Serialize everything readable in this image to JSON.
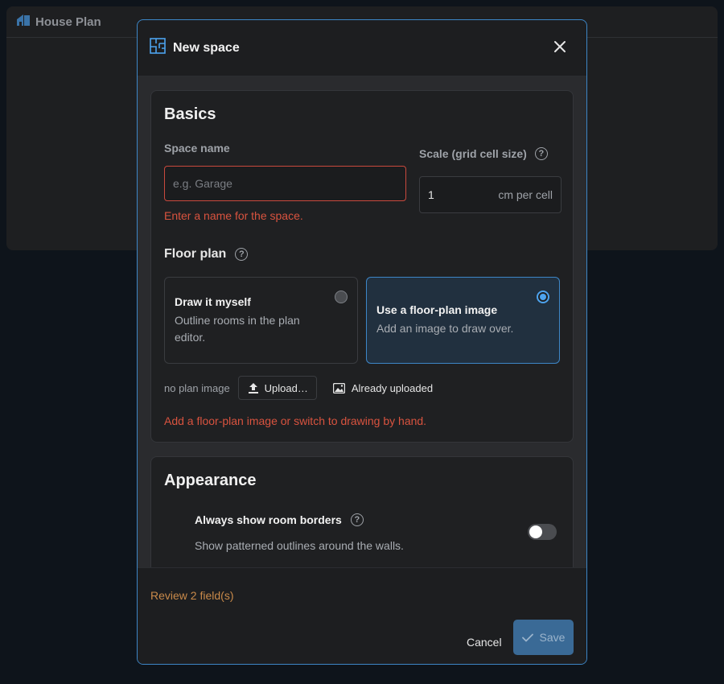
{
  "app": {
    "title": "House Plan"
  },
  "dialog": {
    "title": "New space",
    "basics": {
      "title": "Basics",
      "name_label": "Space name",
      "name_placeholder": "e.g. Garage",
      "name_value": "",
      "name_error": "Enter a name for the space.",
      "scale_label": "Scale (grid cell size)",
      "scale_value": "1",
      "scale_unit": "cm per cell",
      "floor_plan_label": "Floor plan",
      "options": [
        {
          "title": "Draw it myself",
          "desc": "Outline rooms in the plan editor.",
          "selected": false
        },
        {
          "title": "Use a floor-plan image",
          "desc": "Add an image to draw over.",
          "selected": true
        }
      ],
      "no_plan_image": "no plan image",
      "upload_label": "Upload…",
      "already_uploaded_label": "Already uploaded",
      "plan_error": "Add a floor-plan image or switch to drawing by hand."
    },
    "appearance": {
      "title": "Appearance",
      "borders_label": "Always show room borders",
      "borders_desc": "Show patterned outlines around the walls.",
      "borders_on": false
    },
    "footer": {
      "review": "Review 2 field(s)",
      "cancel": "Cancel",
      "save": "Save"
    }
  },
  "colors": {
    "accent": "#3d86c7",
    "error": "#d9533f",
    "warning": "#c98a4a",
    "radio_selected": "#4da3ee"
  }
}
